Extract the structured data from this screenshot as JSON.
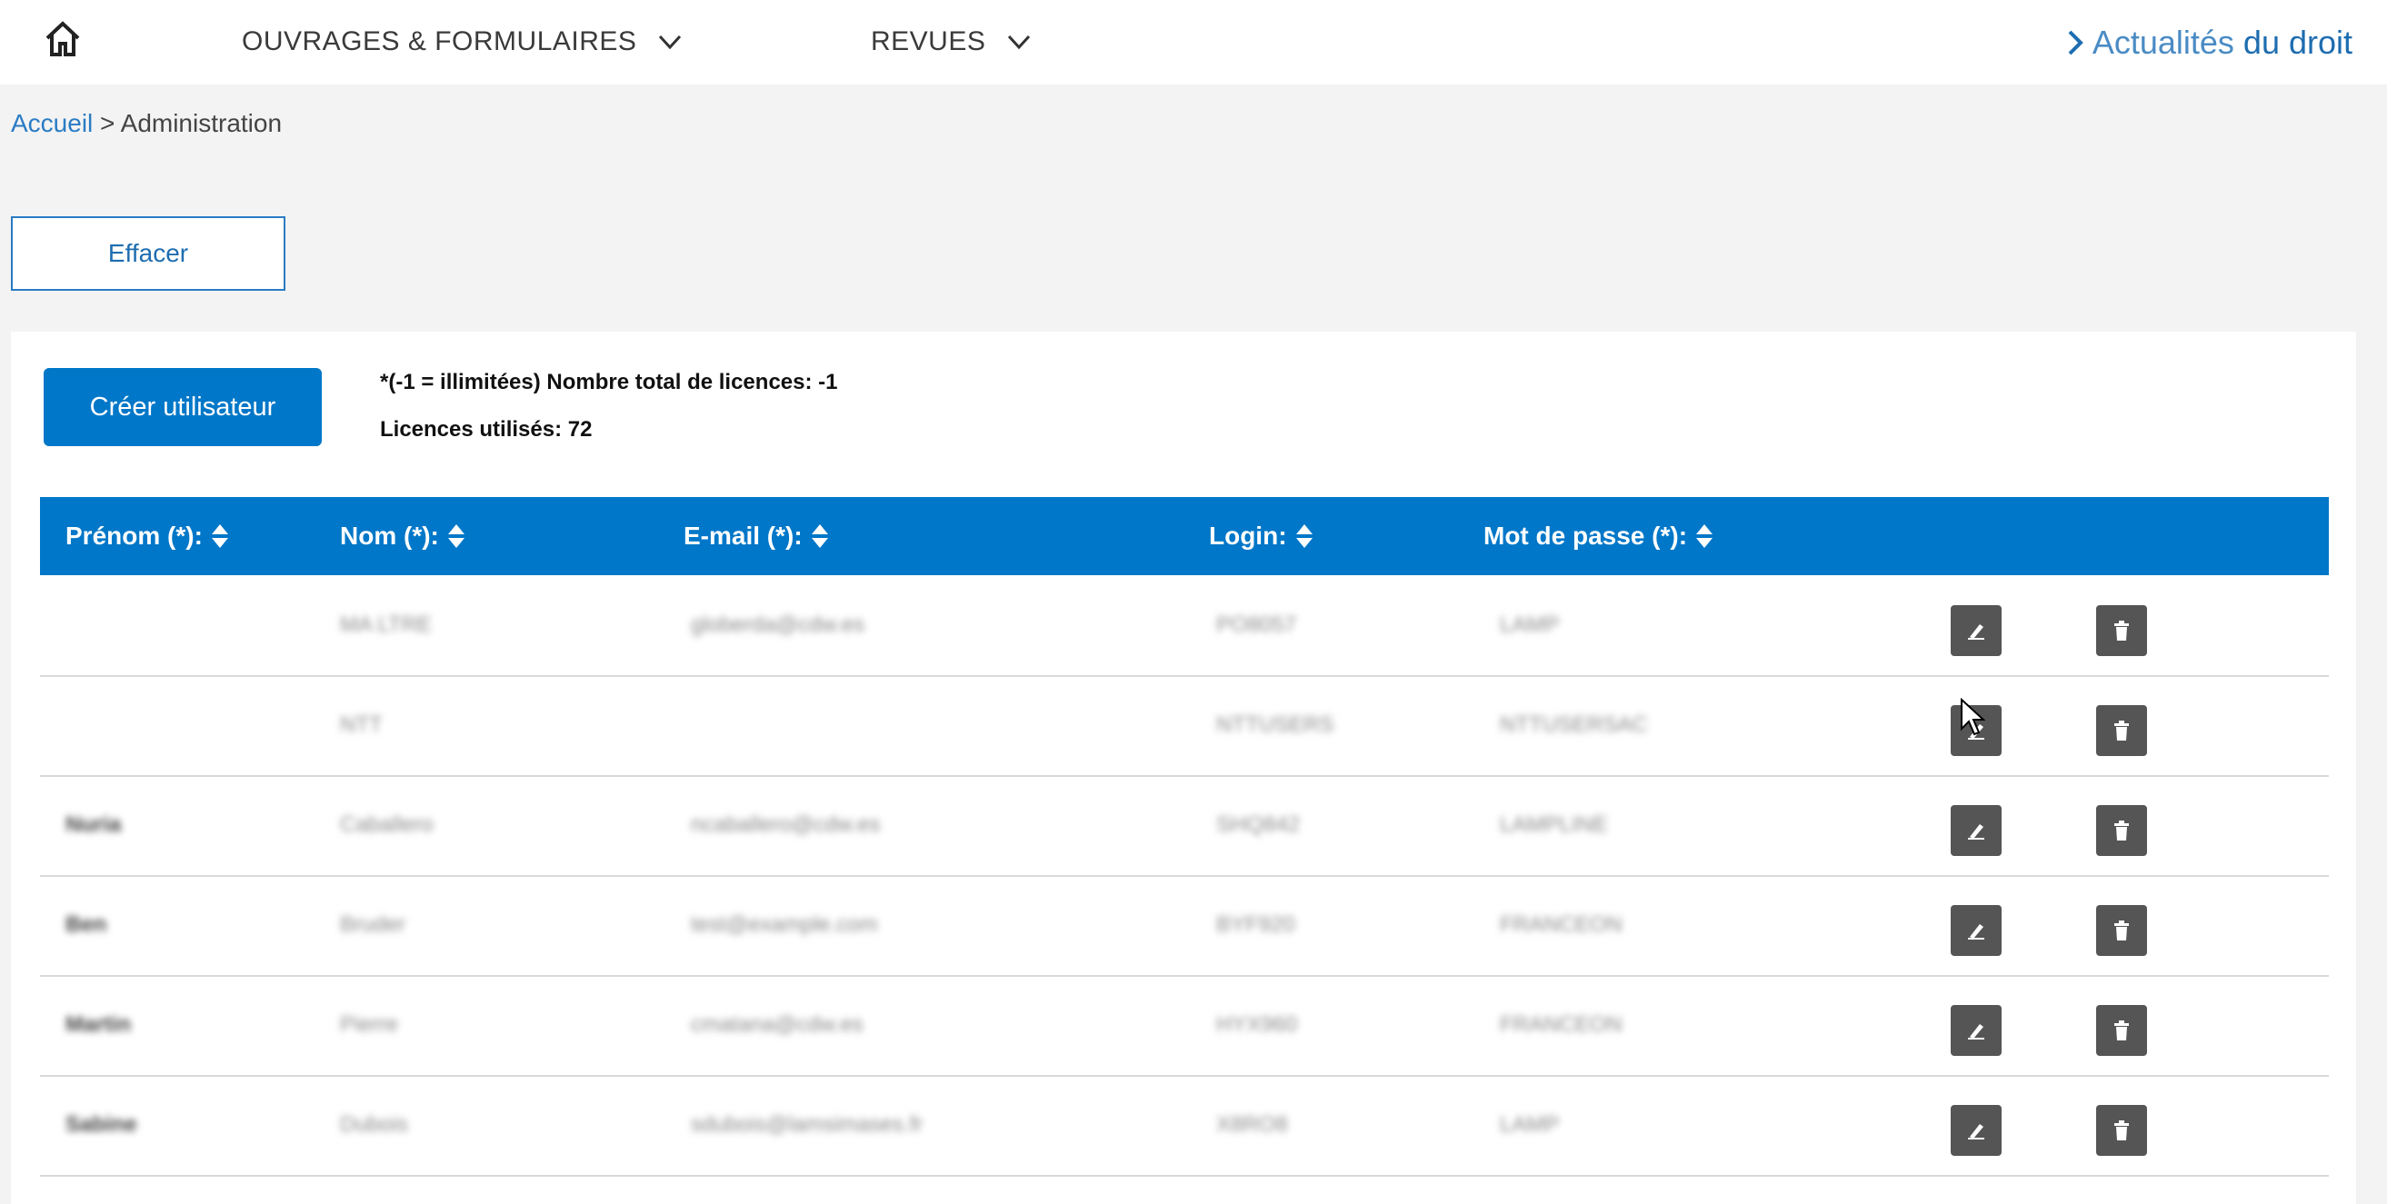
{
  "nav": {
    "items": [
      "OUVRAGES & FORMULAIRES",
      "REVUES"
    ],
    "news_prefix": "Actualités",
    "news_suffix": "du droit"
  },
  "breadcrumb": {
    "home": "Accueil",
    "separator": ">",
    "current": "Administration"
  },
  "clear_button": "Effacer",
  "create_button": "Créer utilisateur",
  "licenses": {
    "total_line": "*(-1 = illimitées) Nombre total de licences: -1",
    "used_line": "Licences utilisés: 72"
  },
  "table": {
    "headers": [
      "Prénom (*):",
      "Nom (*):",
      "E-mail (*):",
      "Login:",
      "Mot de passe (*):"
    ],
    "rows": [
      [
        "",
        "MA LTRE",
        "globerda@cdw.es",
        "PO8057",
        "LAMP"
      ],
      [
        "",
        "NTT",
        "",
        "NTTUSERS",
        "NTTUSERSAC"
      ],
      [
        "Nuria",
        "Caballero",
        "ncaballero@cdw.es",
        "SHQ842",
        "LAMPLINE"
      ],
      [
        "Ben",
        "Bruder",
        "test@example.com",
        "BYF920",
        "FRANCEON"
      ],
      [
        "Martin",
        "Pierre",
        "cmatana@cdw.es",
        "HYX960",
        "FRANCEON"
      ],
      [
        "Sabine",
        "Dubois",
        "sdubois@lamsimases.fr",
        "X8RO8",
        "LAMP"
      ]
    ]
  },
  "colors": {
    "brand_blue": "#0077c8",
    "action_gray": "#555555"
  },
  "icons": [
    "home-icon",
    "chevron-down-icon",
    "chevron-right-icon",
    "sort-icon",
    "edit-icon",
    "trash-icon"
  ]
}
